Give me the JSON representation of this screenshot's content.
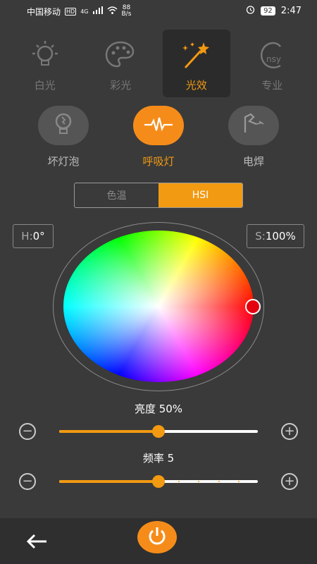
{
  "status_bar": {
    "carrier": "中国移动",
    "hd": "HD",
    "signal": "4G",
    "net_speed_value": "88",
    "net_speed_unit": "B/s",
    "battery": "92",
    "time": "2:47"
  },
  "mode_tabs": [
    {
      "label": "白光",
      "icon": "bulb-icon",
      "active": false
    },
    {
      "label": "彩光",
      "icon": "palette-icon",
      "active": false
    },
    {
      "label": "光效",
      "icon": "magic-wand-icon",
      "active": true
    },
    {
      "label": "专业",
      "icon": "pro-logo-icon",
      "active": false
    }
  ],
  "effects": [
    {
      "label": "坏灯泡",
      "icon": "broken-bulb-icon",
      "active": false
    },
    {
      "label": "呼吸灯",
      "icon": "pulse-icon",
      "active": true
    },
    {
      "label": "电焊",
      "icon": "welding-icon",
      "active": false
    }
  ],
  "segmented": {
    "left": "色温",
    "right": "HSI",
    "active": "right"
  },
  "hue": {
    "key": "H:",
    "value": "0°"
  },
  "saturation": {
    "key": "S:",
    "value": "100%"
  },
  "brightness": {
    "label": "亮度 50%",
    "percent": 50
  },
  "frequency": {
    "label": "频率 5",
    "value": 5,
    "min": 0,
    "max": 10
  },
  "colors": {
    "accent": "#f29a12",
    "background": "#3a3a3a",
    "handle": "#e4000f"
  }
}
